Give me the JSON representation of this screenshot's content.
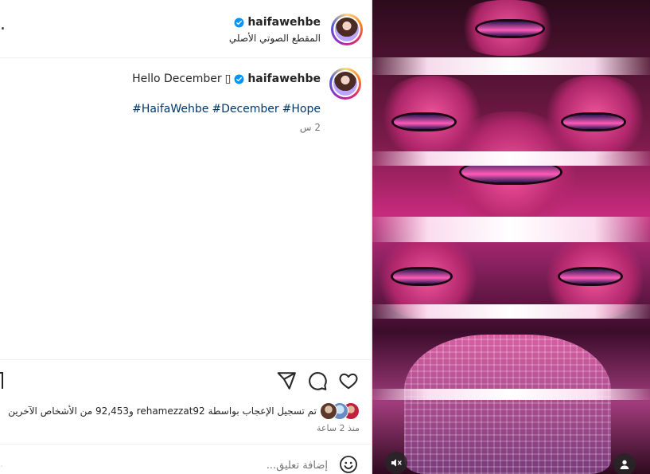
{
  "header": {
    "username": "haifawehbe",
    "audio_label": "المقطع الصوتي الأصلي",
    "more_label": "."
  },
  "caption": {
    "username": "haifawehbe",
    "text": "Hello December",
    "emoji_placeholder": "▯",
    "hashtags": [
      "#HaifaWehbe",
      "#December",
      "#Hope"
    ],
    "time": "2 س"
  },
  "actions": {
    "like_icon": "heart-icon",
    "comment_icon": "comment-icon",
    "share_icon": "send-icon",
    "save_icon": "bookmark-icon"
  },
  "likes": {
    "text": "تم تسجيل الإعجاب بواسطة rehamezzat92 و92,453 من الأشخاص الآخرين",
    "time": "منذ 2 ساعة"
  },
  "comment": {
    "placeholder": "إضافة تعليق...",
    "emoji_icon": "smiley-icon"
  },
  "video": {
    "mute_icon": "speaker-muted-icon",
    "tags_icon": "user-tag-icon"
  },
  "colors": {
    "verified": "#0095f6",
    "hashtag": "#00376b",
    "muted_text": "#737373",
    "divider": "#efefef"
  }
}
